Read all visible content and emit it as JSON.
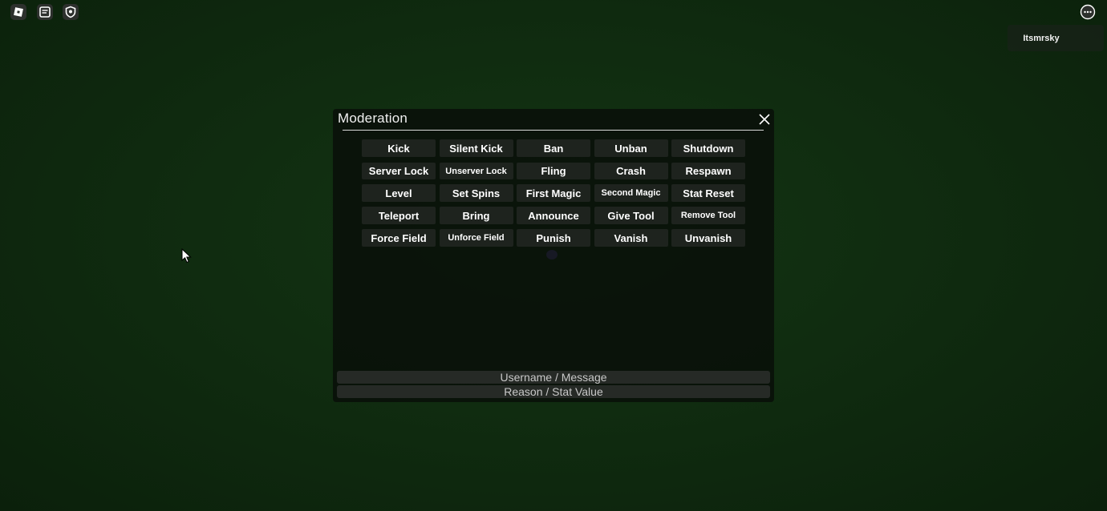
{
  "topbar": {
    "icons": [
      "roblox-logo-icon",
      "chat-icon",
      "shield-icon",
      "more-options-icon"
    ]
  },
  "player_list": {
    "player_name": "Itsmrsky"
  },
  "moderation_panel": {
    "title": "Moderation",
    "close_label": "X",
    "commands": [
      "Kick",
      "Silent Kick",
      "Ban",
      "Unban",
      "Shutdown",
      "Server Lock",
      "Unserver Lock",
      "Fling",
      "Crash",
      "Respawn",
      "Level",
      "Set Spins",
      "First Magic",
      "Second Magic",
      "Stat Reset",
      "Teleport",
      "Bring",
      "Announce",
      "Give Tool",
      "Remove Tool",
      "Force Field",
      "Unforce Field",
      "Punish",
      "Vanish",
      "Unvanish"
    ],
    "username_field": {
      "placeholder": "Username / Message",
      "value": ""
    },
    "reason_field": {
      "placeholder": "Reason / Stat Value",
      "value": ""
    }
  },
  "colors": {
    "background": "#123012",
    "panel": "#080e08",
    "button": "#1e231e",
    "text": "#ffffff"
  }
}
